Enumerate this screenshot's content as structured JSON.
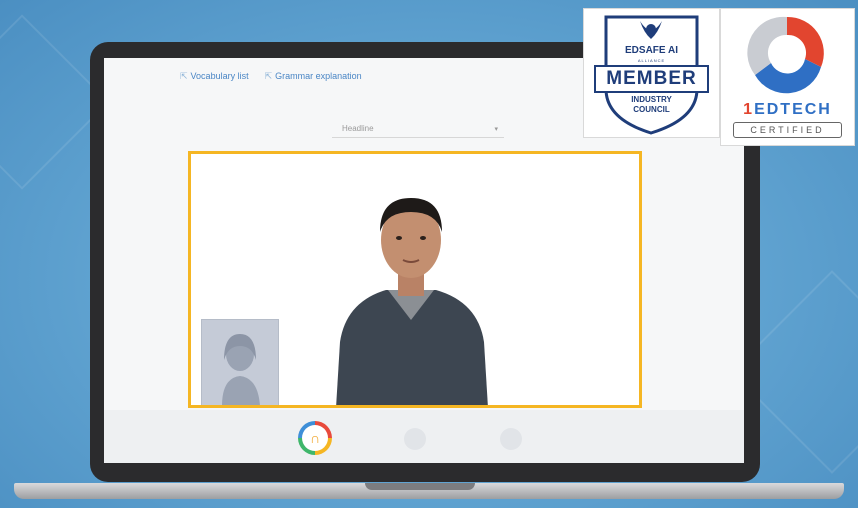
{
  "lesson": {
    "links": [
      {
        "label": "Vocabulary list"
      },
      {
        "label": "Grammar explanation"
      }
    ],
    "dropdown_value": "Headline"
  },
  "badges": {
    "edsafe": {
      "org": "EDSAFE AI",
      "sub": "ALLIANCE",
      "member": "MEMBER",
      "council_line1": "INDUSTRY",
      "council_line2": "COUNCIL"
    },
    "edtech": {
      "name_prefix": "1",
      "name": "EDTECH",
      "status": "CERTIFIED"
    }
  },
  "colors": {
    "background": "#5fa2d0",
    "frame_accent": "#f5b623",
    "link": "#4a86c5",
    "badge_navy": "#1f3d7a",
    "edtech_red": "#e2452f",
    "edtech_blue": "#2f6fc4"
  },
  "icons": {
    "link_icon": "arrow-link-icon",
    "dropdown": "chevron-down-icon",
    "mic": "microphone-icon"
  }
}
